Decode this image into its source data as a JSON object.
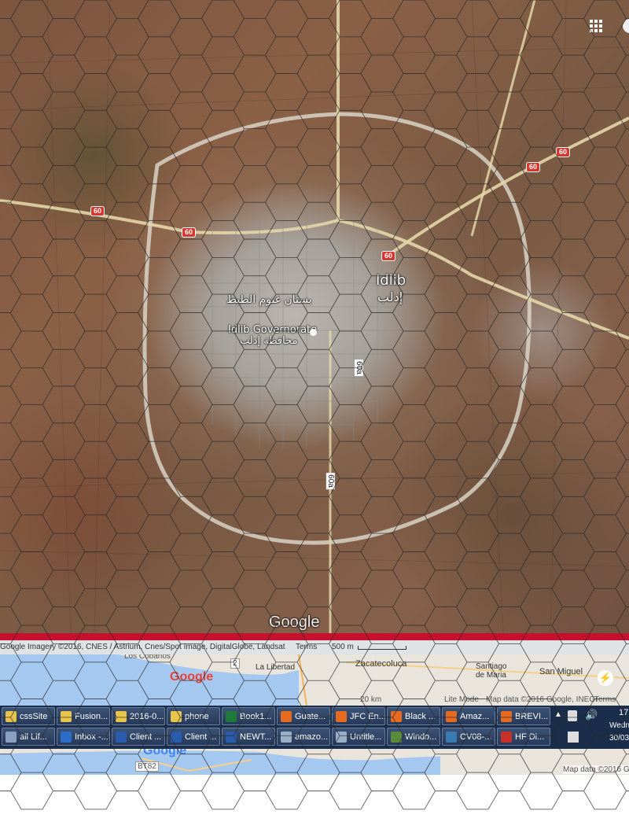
{
  "map": {
    "city_en": "Idlib",
    "city_ar": "إدلب",
    "district_ar": "بستان غنوم الطيط",
    "governorate_en": "Idlib Governorate",
    "governorate_ar": "محافظة إدلب",
    "google_logo": "Google",
    "roads": [
      {
        "id": "60-west",
        "label": "60"
      },
      {
        "id": "60-west2",
        "label": "60"
      },
      {
        "id": "60-center",
        "label": "60"
      },
      {
        "id": "60-east",
        "label": "60"
      },
      {
        "id": "60-east2",
        "label": "60"
      },
      {
        "id": "60a-1",
        "label": "60a"
      },
      {
        "id": "60a-2",
        "label": "60a"
      }
    ],
    "attribution": "Google Imagery ©2016, CNES / Astrium, Cnes/Spot Image, DigitalGlobe, Landsat",
    "terms": "Terms",
    "scale": "500 m"
  },
  "gmap_strip": {
    "places": [
      "Los Cobanos",
      "La Libertad",
      "Zacatecoluca",
      "Santiago de Maria",
      "San Miguel"
    ],
    "google_logo": "Google",
    "scale": "20 km",
    "lite_mode": "Lite Mode",
    "map_data": "Map data ©2016 Google, INEGI",
    "terms": "Terms",
    "route": "2",
    "map_data2": "Map data ©2016 Go",
    "route2": "BT82"
  },
  "taskbar": {
    "row1": [
      {
        "label": "cssSite",
        "icon": "folder-icon",
        "color": "#e8c44a"
      },
      {
        "label": "Fusion...",
        "icon": "folder-icon",
        "color": "#e8c44a"
      },
      {
        "label": "2016-0...",
        "icon": "folder-icon",
        "color": "#e8c44a"
      },
      {
        "label": "phone",
        "icon": "folder-icon",
        "color": "#e8c44a"
      },
      {
        "label": "Book1...",
        "icon": "excel-icon",
        "color": "#1f7a3a"
      },
      {
        "label": "Guate...",
        "icon": "firefox-icon",
        "color": "#e66a1f"
      },
      {
        "label": "JFC En...",
        "icon": "firefox-icon",
        "color": "#e66a1f"
      },
      {
        "label": "Black ...",
        "icon": "firefox-icon",
        "color": "#e66a1f"
      },
      {
        "label": "Amaz...",
        "icon": "firefox-icon",
        "color": "#e66a1f"
      },
      {
        "label": "BREVI...",
        "icon": "firefox-icon",
        "color": "#e66a1f"
      }
    ],
    "row2": [
      {
        "label": "ail Lif...",
        "icon": "generic-icon",
        "color": "#8aa0c0"
      },
      {
        "label": "Inbox -...",
        "icon": "outlook-icon",
        "color": "#2a6ec7"
      },
      {
        "label": "Client ...",
        "icon": "word-icon",
        "color": "#2a5cae"
      },
      {
        "label": "Client ...",
        "icon": "word-icon",
        "color": "#2a5cae"
      },
      {
        "label": "NEWT...",
        "icon": "word-icon",
        "color": "#2a5cae"
      },
      {
        "label": "amazo...",
        "icon": "notepad-icon",
        "color": "#9ab0c9"
      },
      {
        "label": "Untitle...",
        "icon": "notepad-icon",
        "color": "#9ab0c9"
      },
      {
        "label": "Windo...",
        "icon": "window-icon",
        "color": "#5a8a3a"
      },
      {
        "label": "CV08-...",
        "icon": "window-icon",
        "color": "#3a7ab0"
      },
      {
        "label": "HF Di...",
        "icon": "pdf-icon",
        "color": "#c8302a"
      }
    ],
    "clock_time": "17",
    "clock_day": "Wedn",
    "clock_date": "30/03"
  }
}
